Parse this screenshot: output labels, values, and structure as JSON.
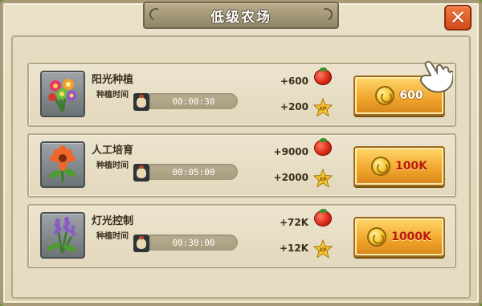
{
  "window": {
    "title": "低级农场",
    "close_icon": "close-icon"
  },
  "rows": [
    {
      "name": "阳光种植",
      "grow_label": "种植时间",
      "time": "00:00:30",
      "tomato_reward": "+600",
      "xp_reward": "+200",
      "price": "600",
      "icon": "flower-bouquet-icon"
    },
    {
      "name": "人工培育",
      "grow_label": "种植时间",
      "time": "00:05:00",
      "tomato_reward": "+9000",
      "xp_reward": "+2000",
      "price": "100K",
      "icon": "orange-flower-icon"
    },
    {
      "name": "灯光控制",
      "grow_label": "种植时间",
      "time": "00:30:00",
      "tomato_reward": "+72K",
      "xp_reward": "+12K",
      "price": "1000K",
      "icon": "lavender-icon"
    }
  ],
  "xp_label": "XP",
  "colors": {
    "panel_bg": "#e6dcc2",
    "button_gold": "#f0a42a",
    "price_red": "#b81a0c",
    "close_orange": "#e0582a"
  }
}
